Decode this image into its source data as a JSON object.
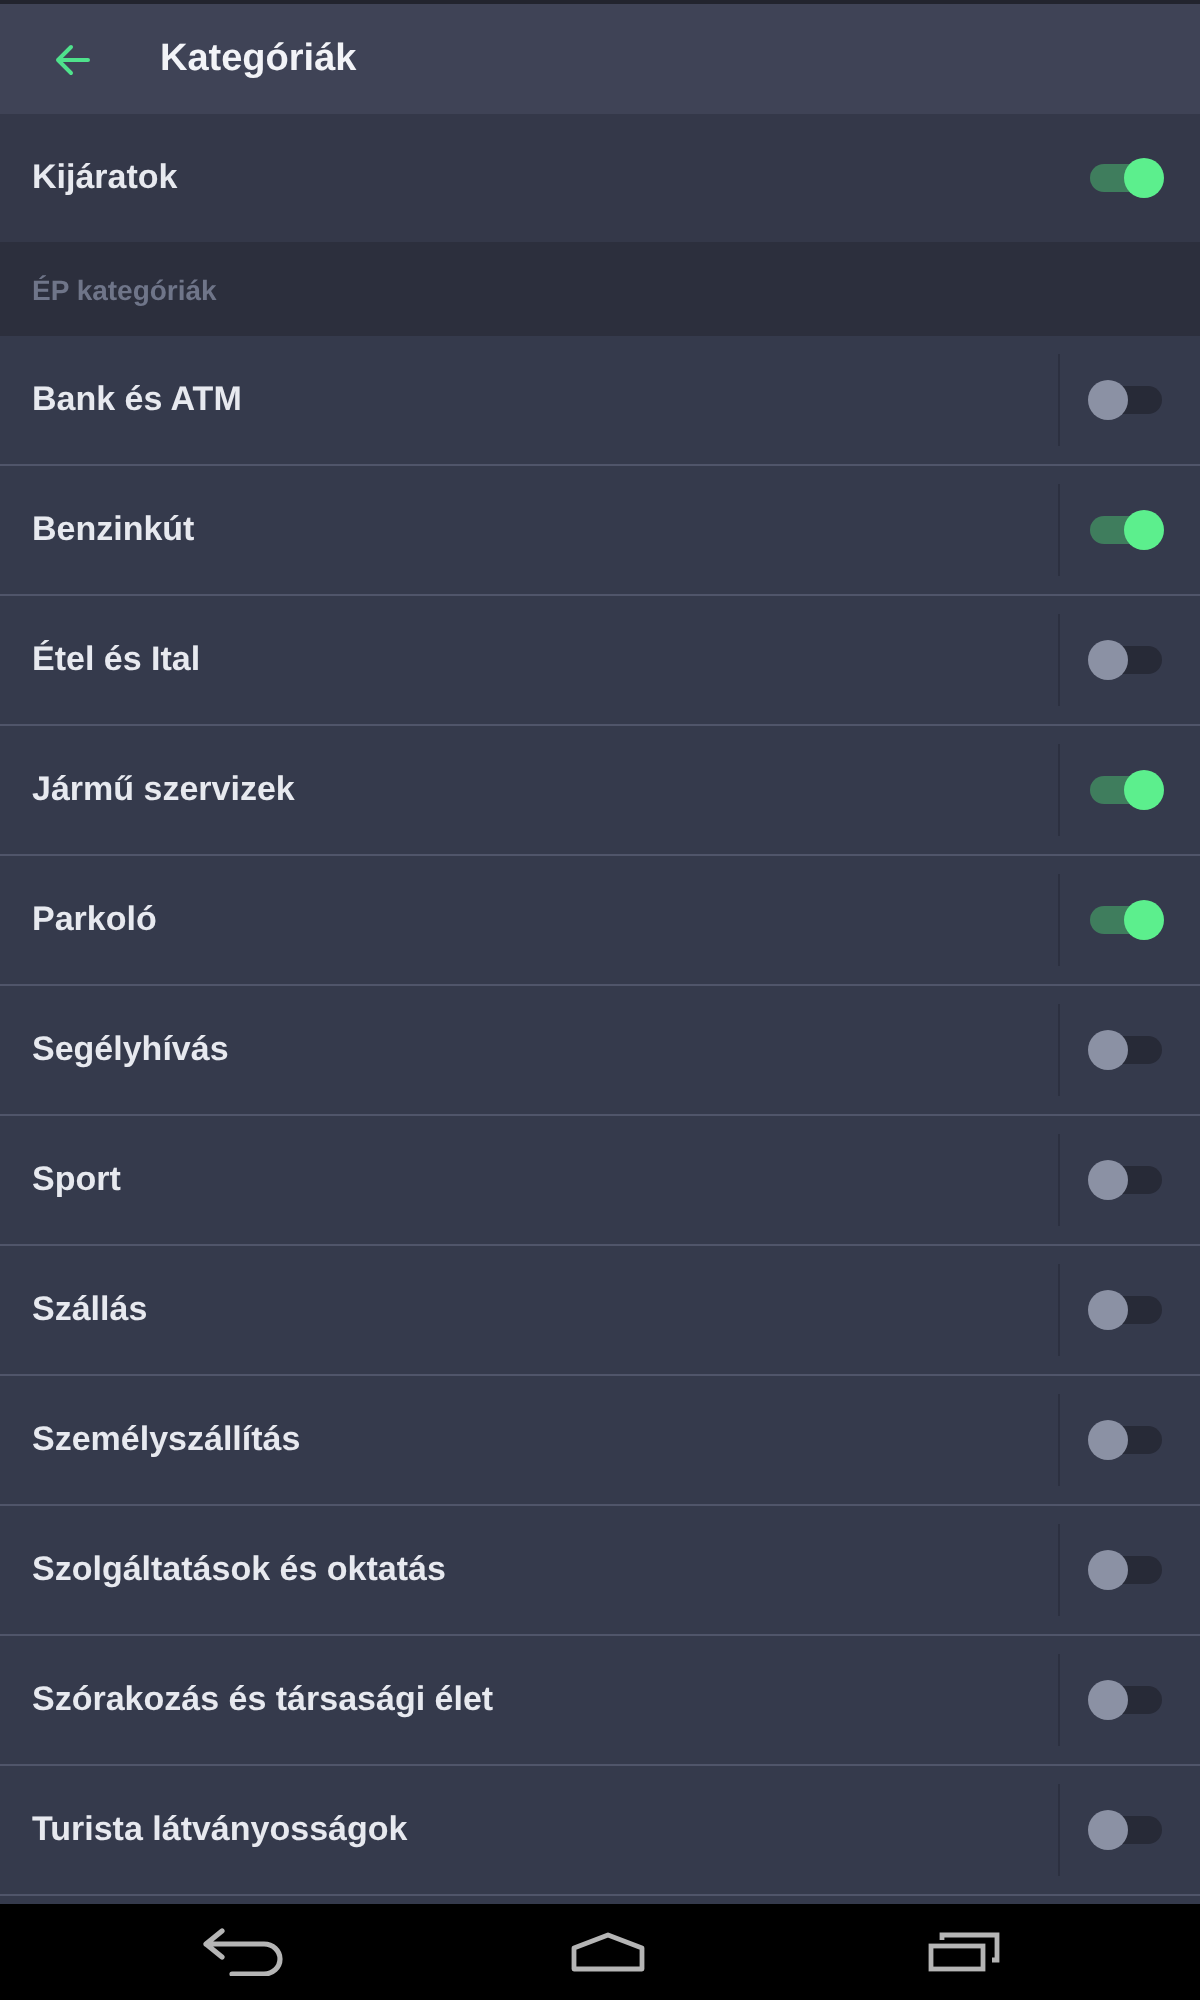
{
  "top_bar": {
    "title": "Kategóriák"
  },
  "master": {
    "label": "Kijáratok",
    "on": true
  },
  "section": {
    "title": "ÉP kategóriák"
  },
  "categories": [
    {
      "label": "Bank és ATM",
      "on": false
    },
    {
      "label": "Benzinkút",
      "on": true
    },
    {
      "label": "Étel és Ital",
      "on": false
    },
    {
      "label": "Jármű szervizek",
      "on": true
    },
    {
      "label": "Parkoló",
      "on": true
    },
    {
      "label": "Segélyhívás",
      "on": false
    },
    {
      "label": "Sport",
      "on": false
    },
    {
      "label": "Szállás",
      "on": false
    },
    {
      "label": "Személyszállítás",
      "on": false
    },
    {
      "label": "Szolgáltatások és oktatás",
      "on": false
    },
    {
      "label": "Szórakozás és társasági élet",
      "on": false
    },
    {
      "label": "Turista látványosságok",
      "on": false
    }
  ]
}
